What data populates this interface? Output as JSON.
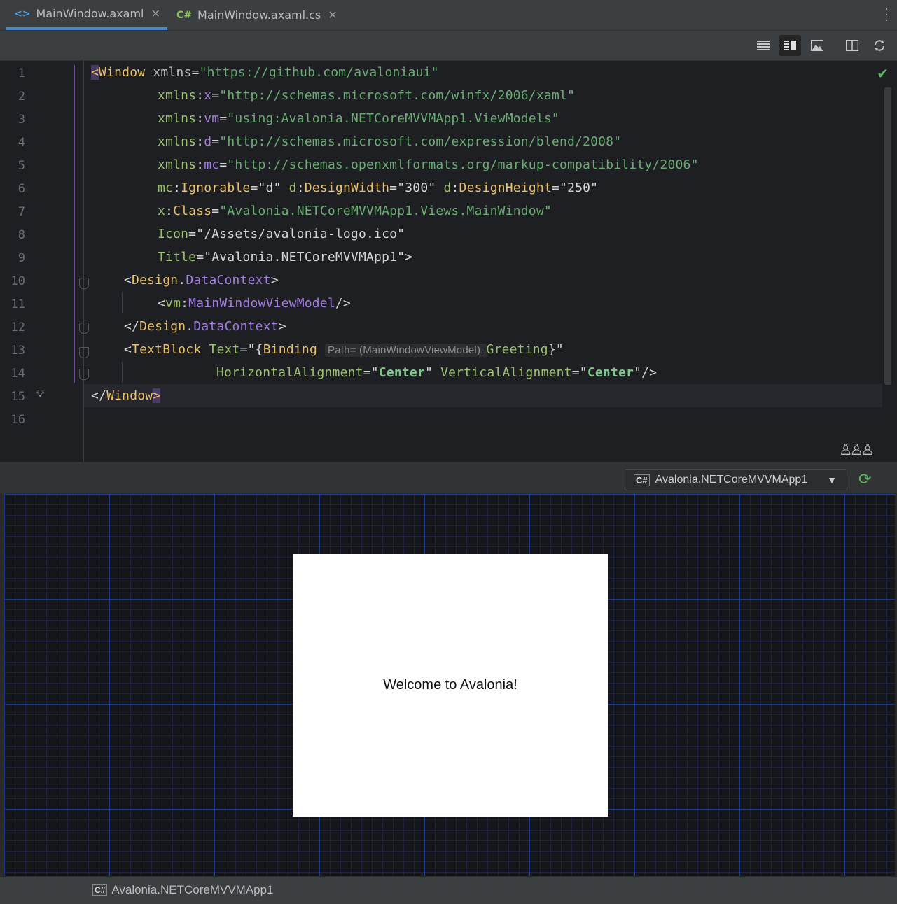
{
  "tabs": [
    {
      "icon": "<>",
      "label": "MainWindow.axaml",
      "close": "✕",
      "active": true
    },
    {
      "icon": "C#",
      "label": "MainWindow.axaml.cs",
      "close": "✕",
      "active": false
    }
  ],
  "toolbar": {
    "buttons": [
      "list-view-icon",
      "split-view-icon",
      "image-view-icon",
      "split-vertical-icon",
      "sync-icon"
    ]
  },
  "editor": {
    "line_numbers": [
      "1",
      "2",
      "3",
      "4",
      "5",
      "6",
      "7",
      "8",
      "9",
      "10",
      "11",
      "12",
      "13",
      "14",
      "15",
      "16"
    ],
    "lines": {
      "l1": {
        "open": "<",
        "tag": "Window",
        "attr": "xmlns",
        "eq": "=",
        "val": "\"https://github.com/avaloniaui\""
      },
      "l2": {
        "ns": "xmlns",
        "colon": ":",
        "attr": "x",
        "eq": "=",
        "val": "\"http://schemas.microsoft.com/winfx/2006/xaml\""
      },
      "l3": {
        "ns": "xmlns",
        "colon": ":",
        "attr": "vm",
        "eq": "=",
        "val": "\"using:Avalonia.NETCoreMVVMApp1.ViewModels\""
      },
      "l4": {
        "ns": "xmlns",
        "colon": ":",
        "attr": "d",
        "eq": "=",
        "val": "\"http://schemas.microsoft.com/expression/blend/2008\""
      },
      "l5": {
        "ns": "xmlns",
        "colon": ":",
        "attr": "mc",
        "eq": "=",
        "val": "\"http://schemas.openxmlformats.org/markup-compatibility/2006\""
      },
      "l6": {
        "p1": "mc",
        "a1": "Ignorable",
        "v1": "=\"d\"",
        "p2": "d",
        "a2": "DesignWidth",
        "v2": "=\"300\"",
        "p3": "d",
        "a3": "DesignHeight",
        "v3": "=\"250\""
      },
      "l7": {
        "p": "x",
        "attr": "Class",
        "eq": "=",
        "val": "\"Avalonia.NETCoreMVVMApp1.Views.MainWindow\""
      },
      "l8": {
        "attr": "Icon",
        "val": "=\"/Assets/avalonia-logo.ico\""
      },
      "l9": {
        "attr": "Title",
        "val": "=\"Avalonia.NETCoreMVVMApp1\">"
      },
      "l10": {
        "open": "<",
        "tag1": "Design",
        "dot": ".",
        "tag2": "DataContext",
        "close": ">"
      },
      "l11": {
        "open": "<",
        "ns": "vm",
        "colon": ":",
        "tag": "MainWindowViewModel",
        "close": "/>"
      },
      "l12": {
        "open": "</",
        "tag1": "Design",
        "dot": ".",
        "tag2": "DataContext",
        "close": ">"
      },
      "l13": {
        "open": "<",
        "tag": "TextBlock",
        "attr": "Text",
        "eq": "=\"{",
        "binding": "Binding",
        "hint": "Path= (MainWindowViewModel).",
        "prop": "Greeting",
        "end": "}\""
      },
      "l14": {
        "a1": "HorizontalAlignment",
        "v1pre": "=\"",
        "v1": "Center",
        "v1post": "\"",
        "a2": "VerticalAlignment",
        "v2pre": "=\"",
        "v2": "Center",
        "v2post": "\"/>"
      },
      "l15": {
        "open": "</",
        "tag": "Window",
        "close": ">"
      }
    }
  },
  "preview": {
    "config_label": "Avalonia.NETCoreMVVMApp1",
    "config_icon": "C#",
    "window_text": "Welcome to Avalonia!"
  },
  "status": {
    "icon": "C#",
    "project": "Avalonia.NETCoreMVVMApp1"
  }
}
